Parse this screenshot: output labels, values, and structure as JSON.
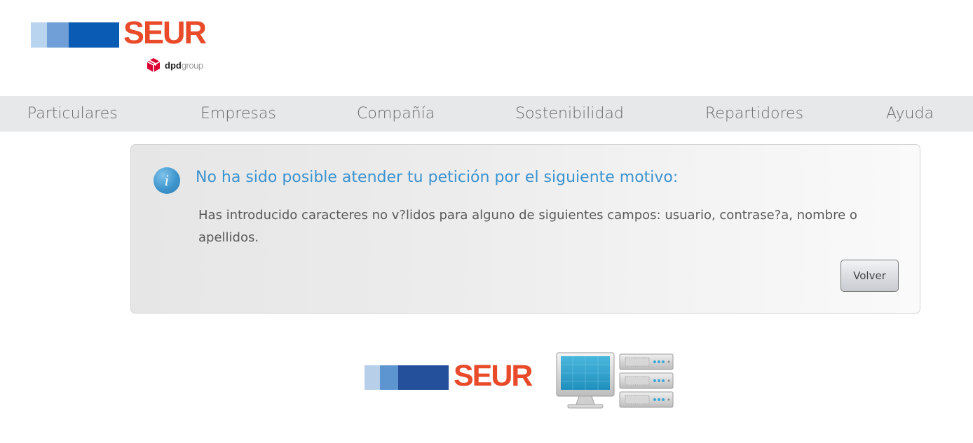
{
  "header": {
    "logo_text": "SEUR",
    "dpd_bold": "dpd",
    "dpd_light": "group"
  },
  "nav": {
    "items": [
      {
        "label": "Particulares"
      },
      {
        "label": "Empresas"
      },
      {
        "label": "Compañía"
      },
      {
        "label": "Sostenibilidad"
      },
      {
        "label": "Repartidores"
      },
      {
        "label": "Ayuda"
      }
    ]
  },
  "message": {
    "icon": "info-icon",
    "title": "No ha sido posible atender tu petición por el siguiente motivo:",
    "body": "Has introducido caracteres no v?lidos para alguno de siguientes campos: usuario, contrase?a, nombre o apellidos.",
    "button_label": "Volver"
  },
  "footer": {
    "logo_text": "SEUR",
    "icons": [
      "computer-icon",
      "servers-icon"
    ]
  },
  "colors": {
    "brand_red": "#e84a2a",
    "brand_blue": "#0a5bb3",
    "title_blue": "#3b93cf",
    "nav_bg": "#e7e8e9"
  }
}
